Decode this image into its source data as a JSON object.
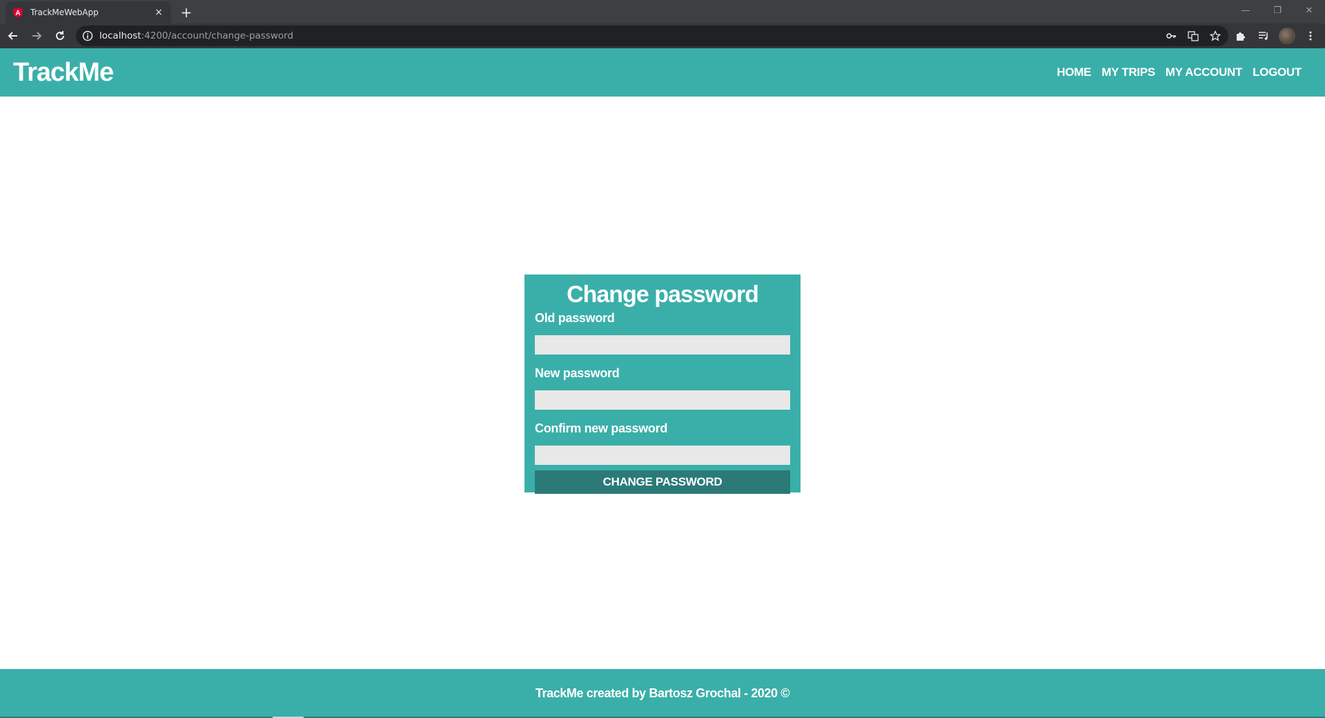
{
  "browser": {
    "tab_title": "TrackMeWebApp",
    "tab_close": "×",
    "new_tab": "+",
    "url_host": "localhost",
    "url_path": ":4200/account/change-password",
    "icons": [
      "angular-favicon",
      "back-icon",
      "forward-icon",
      "reload-icon",
      "info-icon",
      "key-icon",
      "translate-icon",
      "star-icon",
      "extensions-icon",
      "media-icon",
      "profile-avatar",
      "menu-icon"
    ],
    "win_minimize": "—",
    "win_restore": "❐",
    "win_close": "✕"
  },
  "header": {
    "brand": "TrackMe",
    "nav": [
      "HOME",
      "MY TRIPS",
      "MY ACCOUNT",
      "LOGOUT"
    ]
  },
  "form": {
    "title": "Change password",
    "old_password_label": "Old password",
    "new_password_label": "New password",
    "confirm_password_label": "Confirm new password",
    "old_password_value": "",
    "new_password_value": "",
    "confirm_password_value": "",
    "submit_label": "CHANGE PASSWORD"
  },
  "footer": {
    "text": "TrackMe created by Bartosz Grochal - 2020 ©"
  },
  "colors": {
    "brand": "#3aafa9",
    "button": "#2b7a78",
    "input": "#e8e8e8"
  }
}
